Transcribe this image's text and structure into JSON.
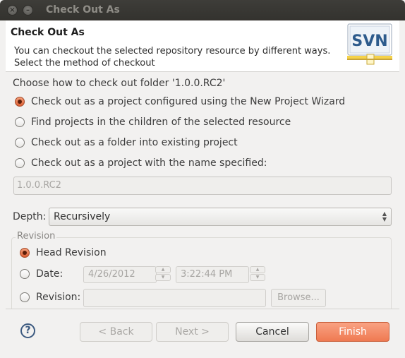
{
  "window": {
    "title": "Check Out As"
  },
  "header": {
    "title": "Check Out As",
    "description": "You can checkout the selected repository resource by different ways. Select the method of checkout",
    "logo_text": "SVN"
  },
  "checkout": {
    "prompt": "Choose how to check out folder '1.0.0.RC2'",
    "options": [
      {
        "label": "Check out as a project configured using the New Project Wizard",
        "checked": true
      },
      {
        "label": "Find projects in the children of the selected resource",
        "checked": false
      },
      {
        "label": "Check out as a folder into existing project",
        "checked": false
      },
      {
        "label": "Check out as a project with the name specified:",
        "checked": false
      }
    ],
    "project_name_value": "1.0.0.RC2"
  },
  "depth": {
    "label": "Depth:",
    "selected": "Recursively"
  },
  "revision": {
    "group_title": "Revision",
    "head_label": "Head Revision",
    "date_label": "Date:",
    "date_value": "4/26/2012",
    "time_value": "3:22:44 PM",
    "revision_label": "Revision:",
    "revision_value": "",
    "browse_label": "Browse...",
    "selected": "head"
  },
  "footer": {
    "help_symbol": "?",
    "back_label": "< Back",
    "next_label": "Next >",
    "cancel_label": "Cancel",
    "finish_label": "Finish"
  },
  "colors": {
    "accent": "#ef7a52",
    "titlebar": "#3e3d39",
    "help_icon": "#3c5a80"
  },
  "icons": [
    "close-icon",
    "minimize-icon",
    "svn-logo-icon",
    "help-icon",
    "spin-up-icon",
    "spin-down-icon",
    "combo-arrows-icon"
  ]
}
